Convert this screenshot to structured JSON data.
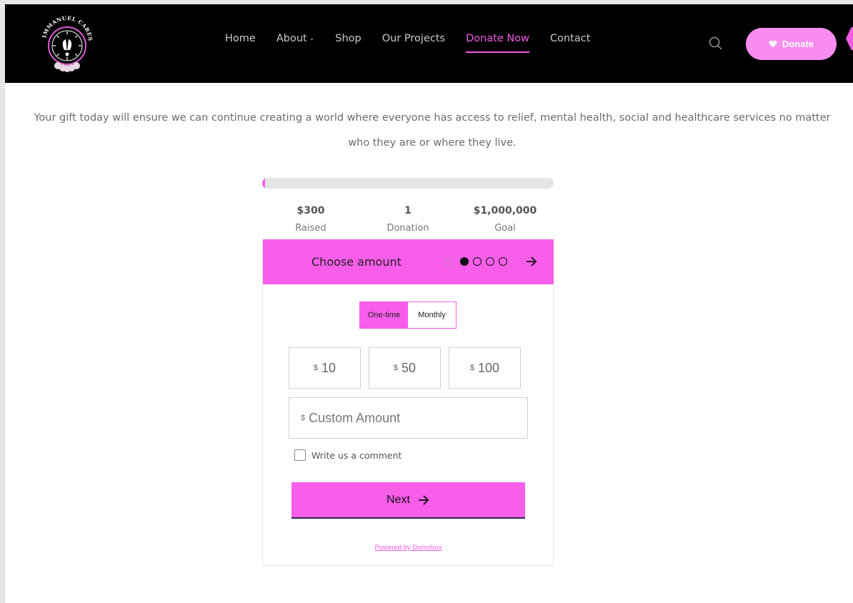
{
  "header": {
    "logo_text": "IMMANUEL CARES",
    "nav": [
      {
        "label": "Home"
      },
      {
        "label": "About"
      },
      {
        "label": "Shop"
      },
      {
        "label": "Our Projects"
      },
      {
        "label": "Donate Now",
        "active": true
      },
      {
        "label": "Contact"
      }
    ],
    "donate_label": "Donate",
    "accent_color": "#f25ce5"
  },
  "intro": "Your gift today will ensure we can continue creating a world where everyone has access to relief, mental health,  social and healthcare services no matter who they are or where they live.",
  "campaign": {
    "progress_percent": 0.03,
    "raised": {
      "value": "$300",
      "label": "Raised"
    },
    "donations": {
      "value": "1",
      "label": "Donation"
    },
    "goal": {
      "value": "$1,000,000",
      "label": "Goal"
    }
  },
  "widget": {
    "title": "Choose amount",
    "step_current": 1,
    "step_total": 4,
    "frequency": {
      "one_time": "One-time",
      "monthly": "Monthly",
      "selected": "one_time"
    },
    "currency_symbol": "$",
    "amounts": [
      "10",
      "50",
      "100"
    ],
    "custom_placeholder": "Custom Amount",
    "comment_label": "Write us a comment",
    "next_label": "Next",
    "powered_by": "Powered by Donorbox"
  }
}
